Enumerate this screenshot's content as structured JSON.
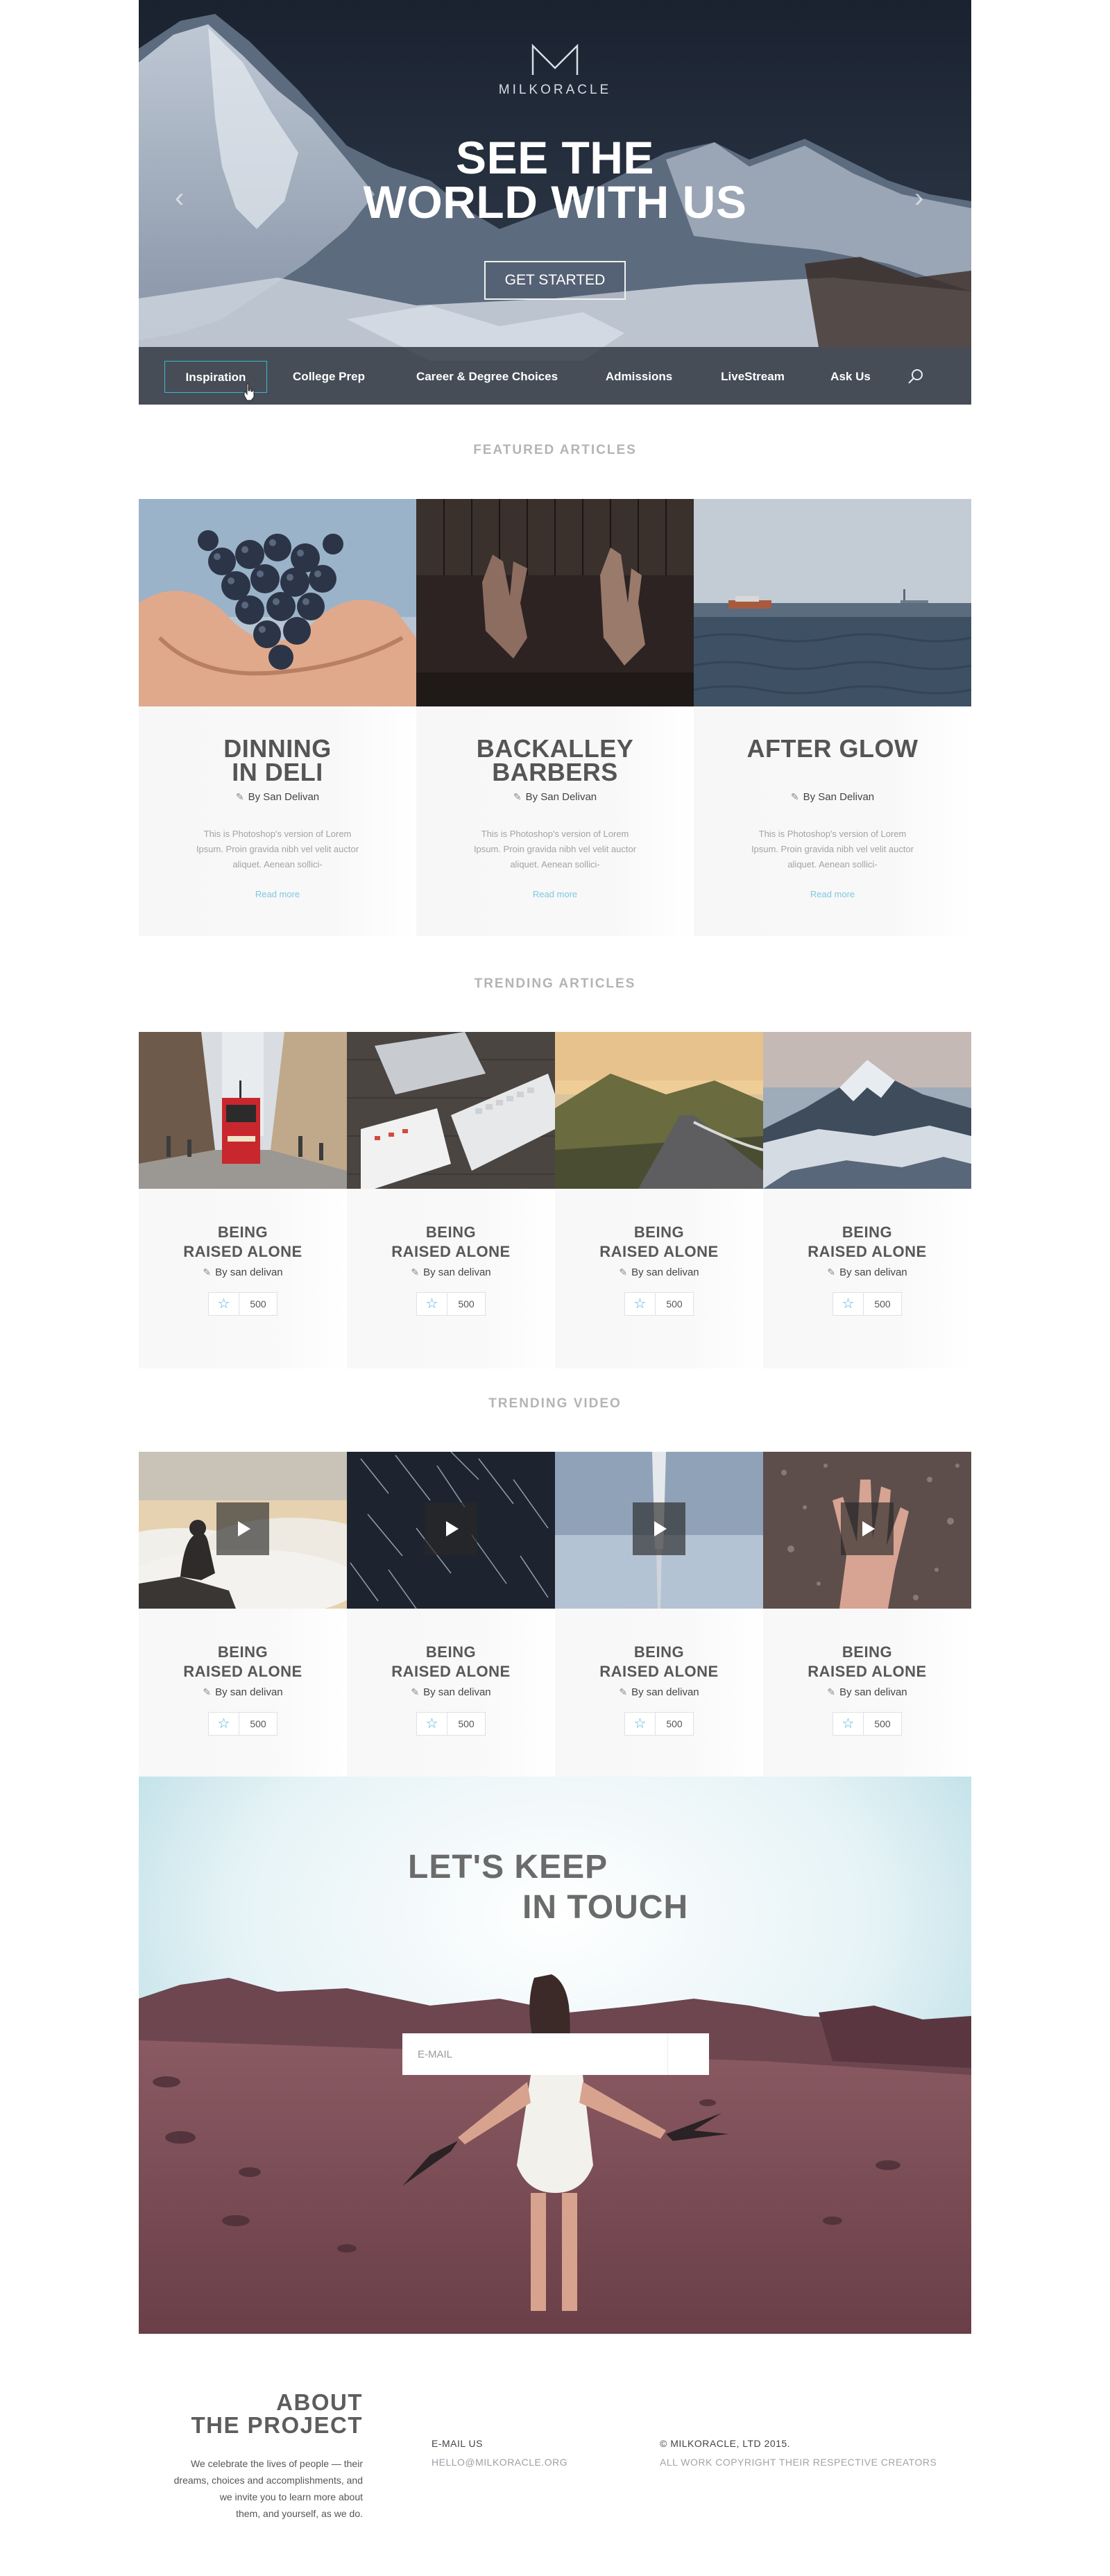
{
  "hero": {
    "logo_text": "MILKORACLE",
    "title_line1": "SEE THE",
    "title_line2": "WORLD WITH US",
    "cta_label": "GET STARTED",
    "prev_glyph": "‹",
    "next_glyph": "›"
  },
  "nav": {
    "items": [
      {
        "label": "Inspiration",
        "active": true
      },
      {
        "label": "College Prep"
      },
      {
        "label": "Career & Degree Choices"
      },
      {
        "label": "Admissions"
      },
      {
        "label": "LiveStream"
      },
      {
        "label": "Ask Us"
      }
    ],
    "search_icon": "search-icon"
  },
  "featured": {
    "title": "FEATURED ARTICLES",
    "cards": [
      {
        "title_line1": "DINNING",
        "title_line2": "IN DELI",
        "author": "By San Delivan",
        "excerpt": "This is Photoshop's version  of Lorem Ipsum. Proin gravida nibh vel velit auctor aliquet. Aenean sollici-",
        "more": "Read more"
      },
      {
        "title_line1": "BACKALLEY",
        "title_line2": "BARBERS",
        "author": "By San Delivan",
        "excerpt": "This is Photoshop's version  of Lorem Ipsum. Proin gravida nibh vel velit auctor aliquet. Aenean sollici-",
        "more": "Read more"
      },
      {
        "title_line1": "AFTER GLOW",
        "title_line2": "",
        "author": "By San Delivan",
        "excerpt": "This is Photoshop's version  of Lorem Ipsum. Proin gravida nibh vel velit auctor aliquet. Aenean sollici-",
        "more": "Read more"
      }
    ]
  },
  "trending_articles": {
    "title": "TRENDING ARTICLES",
    "cards": [
      {
        "title_line1": "BEING",
        "title_line2": "RAISED ALONE",
        "author": "By san delivan",
        "rating": "500"
      },
      {
        "title_line1": "BEING",
        "title_line2": "RAISED ALONE",
        "author": "By san delivan",
        "rating": "500"
      },
      {
        "title_line1": "BEING",
        "title_line2": "RAISED ALONE",
        "author": "By san delivan",
        "rating": "500"
      },
      {
        "title_line1": "BEING",
        "title_line2": "RAISED ALONE",
        "author": "By san delivan",
        "rating": "500"
      }
    ]
  },
  "trending_video": {
    "title": "TRENDING VIDEO",
    "cards": [
      {
        "title_line1": "BEING",
        "title_line2": "RAISED ALONE",
        "author": "By san delivan",
        "rating": "500"
      },
      {
        "title_line1": "BEING",
        "title_line2": "RAISED ALONE",
        "author": "By san delivan",
        "rating": "500"
      },
      {
        "title_line1": "BEING",
        "title_line2": "RAISED ALONE",
        "author": "By san delivan",
        "rating": "500"
      },
      {
        "title_line1": "BEING",
        "title_line2": "RAISED ALONE",
        "author": "By san delivan",
        "rating": "500"
      }
    ]
  },
  "touch": {
    "title_line1": "LET'S KEEP",
    "title_line2": "IN TOUCH",
    "email_placeholder": "E-MAIL"
  },
  "footer": {
    "about_line1": "ABOUT",
    "about_line2": "THE PROJECT",
    "about_text": [
      "We celebrate the lives of people — their",
      "dreams, choices and accomplishments, and",
      "we invite you to learn more about",
      "them, and yourself, as we do."
    ],
    "email_label": "E-MAIL US",
    "email_value": "HELLO@MILKORACLE.ORG",
    "copyright": "© MILKORACLE, LTD 2015.",
    "copyright_sub": "ALL WORK COPYRIGHT THEIR RESPECTIVE CREATORS"
  },
  "colors": {
    "accent": "#4cb6d6",
    "read_more": "#7fc8e0",
    "nav_active_border": "#3fb5cf",
    "section_title": "#b4b4b4"
  },
  "icons": {
    "star": "☆",
    "pen": "✎",
    "star_icon": "star-icon",
    "pen_icon": "pen-icon",
    "send_icon": "paper-plane-icon",
    "play_icon": "play-icon"
  }
}
